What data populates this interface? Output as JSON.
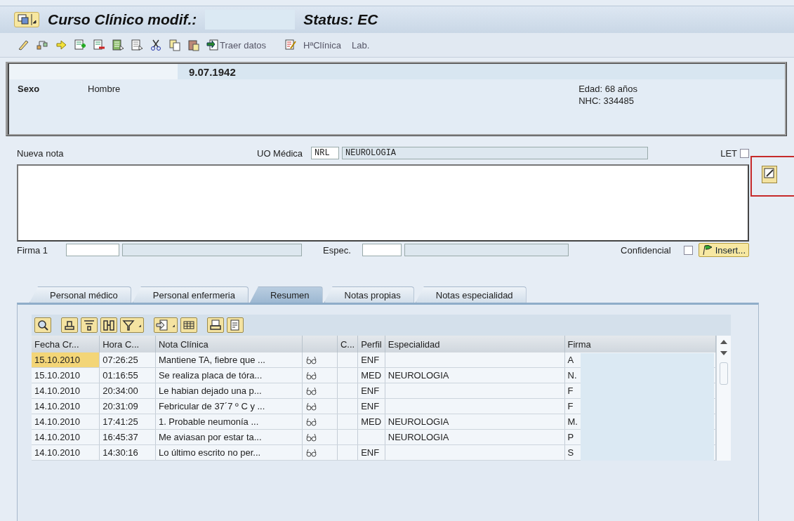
{
  "title": {
    "text": "Curso Clínico modif.:",
    "status": "Status: EC"
  },
  "toolbar": [
    {
      "label": "Traer datos"
    },
    {
      "label": "HªClínica"
    },
    {
      "label": "Lab."
    }
  ],
  "patient": {
    "birth_date": "9.07.1942",
    "sex_label": "Sexo",
    "sex": "Hombre",
    "age": "Edad: 68 años",
    "nhc": "NHC: 334485"
  },
  "note": {
    "label": "Nueva nota",
    "uo_label": "UO Médica",
    "uo_code": "NRL",
    "uo_name": "NEUROLOGIA",
    "let_label": "LET",
    "let_checked": false,
    "firma_label": "Firma 1",
    "espec_label": "Espec.",
    "confidencial_label": "Confidencial",
    "confidencial_checked": false,
    "insert_button": "Insert..."
  },
  "tabs": [
    {
      "label": "Personal médico",
      "selected": false
    },
    {
      "label": "Personal enfermeria",
      "selected": false
    },
    {
      "label": "Resumen",
      "selected": true
    },
    {
      "label": "Notas propias",
      "selected": false
    },
    {
      "label": "Notas especialidad",
      "selected": false
    }
  ],
  "table": {
    "columns": [
      {
        "label": "Fecha Cr..."
      },
      {
        "label": "Hora C..."
      },
      {
        "label": "Nota Clínica"
      },
      {
        "kind": "icon"
      },
      {
        "label": "C..."
      },
      {
        "label": "Perfil"
      },
      {
        "label": "Especialidad"
      },
      {
        "label": "Firma"
      }
    ],
    "rows": [
      {
        "fecha": "15.10.2010",
        "hora": "07:26:25",
        "nota": "Mantiene TA, fiebre que ...",
        "perfil": "ENF",
        "especialidad": "",
        "firma": "A",
        "selected": true
      },
      {
        "fecha": "15.10.2010",
        "hora": "01:16:55",
        "nota": "Se realiza placa de tóra...",
        "perfil": "MED",
        "especialidad": "NEUROLOGIA",
        "firma": "N.",
        "selected": false
      },
      {
        "fecha": "14.10.2010",
        "hora": "20:34:00",
        "nota": "Le habian dejado una p...",
        "perfil": "ENF",
        "especialidad": "",
        "firma": "F",
        "selected": false
      },
      {
        "fecha": "14.10.2010",
        "hora": "20:31:09",
        "nota": "Febricular de 37´7 º C y ...",
        "perfil": "ENF",
        "especialidad": "",
        "firma": "F",
        "selected": false
      },
      {
        "fecha": "14.10.2010",
        "hora": "17:41:25",
        "nota": "1. Probable neumonía  ...",
        "perfil": "MED",
        "especialidad": "NEUROLOGIA",
        "firma": "M.",
        "selected": false
      },
      {
        "fecha": "14.10.2010",
        "hora": "16:45:37",
        "nota": "Me aviasan por estar ta...",
        "perfil": "",
        "especialidad": "NEUROLOGIA",
        "firma": "P",
        "selected": false
      },
      {
        "fecha": "14.10.2010",
        "hora": "14:30:16",
        "nota": "Lo último escrito no per...",
        "perfil": "ENF",
        "especialidad": "",
        "firma": "S",
        "selected": false
      }
    ]
  }
}
